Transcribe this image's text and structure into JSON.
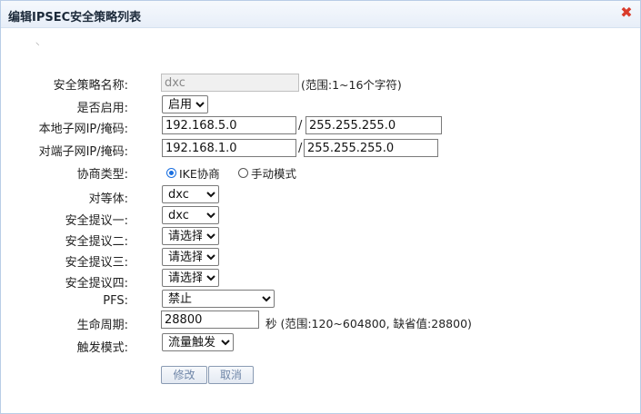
{
  "dialog": {
    "title": "编辑IPSEC安全策略列表",
    "close_glyph": "✖"
  },
  "form": {
    "policy_name": {
      "label": "安全策略名称:",
      "value": "dxc",
      "hint": "(范围:1~16个字符)"
    },
    "enabled": {
      "label": "是否启用:",
      "selected": "启用"
    },
    "local_subnet": {
      "label": "本地子网IP/掩码:",
      "ip": "192.168.5.0",
      "separator": "/",
      "mask": "255.255.255.0"
    },
    "remote_subnet": {
      "label": "对端子网IP/掩码:",
      "ip": "192.168.1.0",
      "separator": "/",
      "mask": "255.255.255.0"
    },
    "negotiation": {
      "label": "协商类型:",
      "option_ike": "IKE协商",
      "option_manual": "手动模式",
      "selected": "IKE协商"
    },
    "peer": {
      "label": "对等体:",
      "selected": "dxc"
    },
    "proposal1": {
      "label": "安全提议一:",
      "selected": "dxc"
    },
    "proposal2": {
      "label": "安全提议二:",
      "selected": "请选择"
    },
    "proposal3": {
      "label": "安全提议三:",
      "selected": "请选择"
    },
    "proposal4": {
      "label": "安全提议四:",
      "selected": "请选择"
    },
    "pfs": {
      "label": "PFS:",
      "selected": "禁止"
    },
    "lifetime": {
      "label": "生命周期:",
      "value": "28800",
      "hint": "秒 (范围:120~604800, 缺省值:28800)"
    },
    "trigger": {
      "label": "触发模式:",
      "selected": "流量触发"
    }
  },
  "buttons": {
    "modify": "修改",
    "cancel": "取消"
  },
  "colors": {
    "close_icon": "#d93b2b",
    "radio_accent": "#1a6fe0",
    "button_text": "#6f86a8"
  }
}
